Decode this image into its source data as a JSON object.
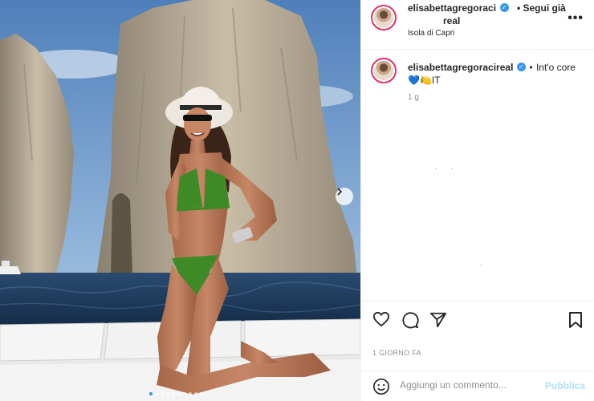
{
  "post": {
    "username": "elisabettagregoracireal",
    "username_header_line1": "elisabettagregoraci",
    "username_header_line2": "real",
    "follow_label": "• Segui già",
    "location": "Isola di Capri",
    "more_icon": "•••",
    "caption_separator": "•",
    "caption": "Int'o core",
    "caption_emojis": "💙🍋IT",
    "time_ago": "1 g",
    "date_label": "1 GIORNO FA",
    "verified_glyph": "✓"
  },
  "comment": {
    "placeholder": "Aggiungi un commento...",
    "publish_label": "Pubblica"
  },
  "carousel": {
    "total": 10,
    "active_index": 0
  },
  "icons": {
    "like": "heart-icon",
    "comment": "comment-icon",
    "share": "share-icon",
    "save": "bookmark-icon",
    "emoji": "emoji-icon",
    "next": "chevron-right-icon",
    "more": "more-icon"
  },
  "colors": {
    "story_ring": "#e1306c",
    "verified": "#3897f0",
    "publish_disabled": "#b2dffc",
    "bikini": "#3e8a26",
    "sky": "#5a8ac0",
    "sea": "#1d3a5a"
  }
}
